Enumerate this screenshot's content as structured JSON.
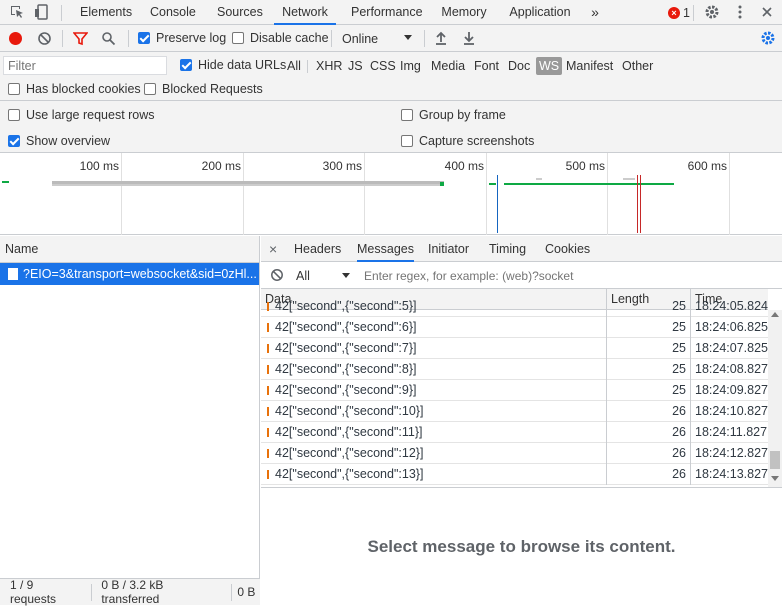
{
  "tabs": {
    "items": [
      "Elements",
      "Console",
      "Sources",
      "Network",
      "Performance",
      "Memory",
      "Application"
    ],
    "more": "»",
    "error_count": "1"
  },
  "toolbar": {
    "preserve_log": "Preserve log",
    "disable_cache": "Disable cache",
    "throttle": "Online"
  },
  "filter": {
    "placeholder": "Filter",
    "hide_data_urls": "Hide data URLs",
    "types": [
      "All",
      "XHR",
      "JS",
      "CSS",
      "Img",
      "Media",
      "Font",
      "Doc",
      "WS",
      "Manifest",
      "Other"
    ],
    "active_type": "WS",
    "has_blocked_cookies": "Has blocked cookies",
    "blocked_requests": "Blocked Requests"
  },
  "settings": {
    "large_rows": "Use large request rows",
    "show_overview": "Show overview",
    "group_by_frame": "Group by frame",
    "capture_screenshots": "Capture screenshots"
  },
  "overview": {
    "ticks": [
      "100 ms",
      "200 ms",
      "300 ms",
      "400 ms",
      "500 ms",
      "600 ms"
    ]
  },
  "requests": {
    "header": "Name",
    "selected": "?EIO=3&transport=websocket&sid=0zHl...",
    "status_count": "1 / 9 requests",
    "status_transferred": "0 B / 3.2 kB transferred",
    "status_cut": "0 B"
  },
  "detail": {
    "close": "×",
    "tabs": [
      "Headers",
      "Messages",
      "Initiator",
      "Timing",
      "Cookies"
    ],
    "active_tab": "Messages",
    "msg_filter_value": "All",
    "msg_filter_placeholder": "Enter regex, for example: (web)?socket",
    "columns": [
      "Data",
      "Length",
      "Time"
    ],
    "partial_row": {
      "data": "42[\"second\",{\"second\":5}]",
      "length": "25",
      "time": "18:24:05.824"
    },
    "rows": [
      {
        "data": "42[\"second\",{\"second\":6}]",
        "length": "25",
        "time": "18:24:06.825"
      },
      {
        "data": "42[\"second\",{\"second\":7}]",
        "length": "25",
        "time": "18:24:07.825"
      },
      {
        "data": "42[\"second\",{\"second\":8}]",
        "length": "25",
        "time": "18:24:08.827"
      },
      {
        "data": "42[\"second\",{\"second\":9}]",
        "length": "25",
        "time": "18:24:09.827"
      },
      {
        "data": "42[\"second\",{\"second\":10}]",
        "length": "26",
        "time": "18:24:10.827"
      },
      {
        "data": "42[\"second\",{\"second\":11}]",
        "length": "26",
        "time": "18:24:11.827"
      },
      {
        "data": "42[\"second\",{\"second\":12}]",
        "length": "26",
        "time": "18:24:12.827"
      },
      {
        "data": "42[\"second\",{\"second\":13}]",
        "length": "26",
        "time": "18:24:13.827"
      }
    ],
    "empty_message": "Select message to browse its content."
  },
  "colors": {
    "accent": "#1a73e8",
    "record": "#e8190c",
    "outgoing_arrow": "#e8710a",
    "ws_green": "#0ea944"
  }
}
